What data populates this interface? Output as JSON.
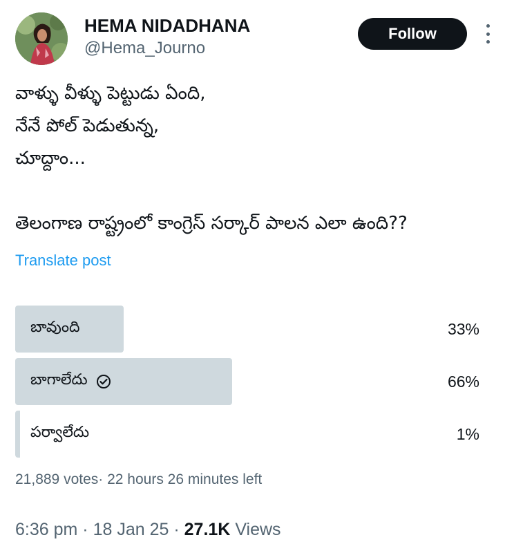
{
  "author": {
    "display_name": "HEMA NIDADHANA",
    "handle": "@Hema_Journo",
    "avatar_alt": "avatar"
  },
  "follow_label": "Follow",
  "tweet": {
    "lines": [
      "వాళ్ళు వీళ్ళు పెట్టుడు ఏంది,",
      "నేనే పోల్ పెడుతున్న,",
      "చూద్దాం...",
      "",
      "తెలంగాణ రాష్ట్రంలో కాంగ్రెస్ సర్కార్ పాలన ఎలా ఉంది??"
    ]
  },
  "translate_label": "Translate post",
  "poll": {
    "options": [
      {
        "label": "బావుంది",
        "percent_text": "33%",
        "percent": 33,
        "selected": false
      },
      {
        "label": "బాగాలేదు",
        "percent_text": "66%",
        "percent": 66,
        "selected": true
      },
      {
        "label": "పర్వాలేదు",
        "percent_text": "1%",
        "percent": 1,
        "selected": false
      }
    ],
    "votes": "21,889 votes",
    "separator": "·",
    "time_left": "22 hours 26 minutes left"
  },
  "footer": {
    "time": "6:36 pm",
    "sep1": "·",
    "date": "18 Jan 25",
    "sep2": "·",
    "views_count": "27.1K",
    "views_label": "Views"
  },
  "colors": {
    "accent": "#1d9bf0",
    "bar": "#cfd9de",
    "text": "#0f1419",
    "muted": "#536471"
  }
}
